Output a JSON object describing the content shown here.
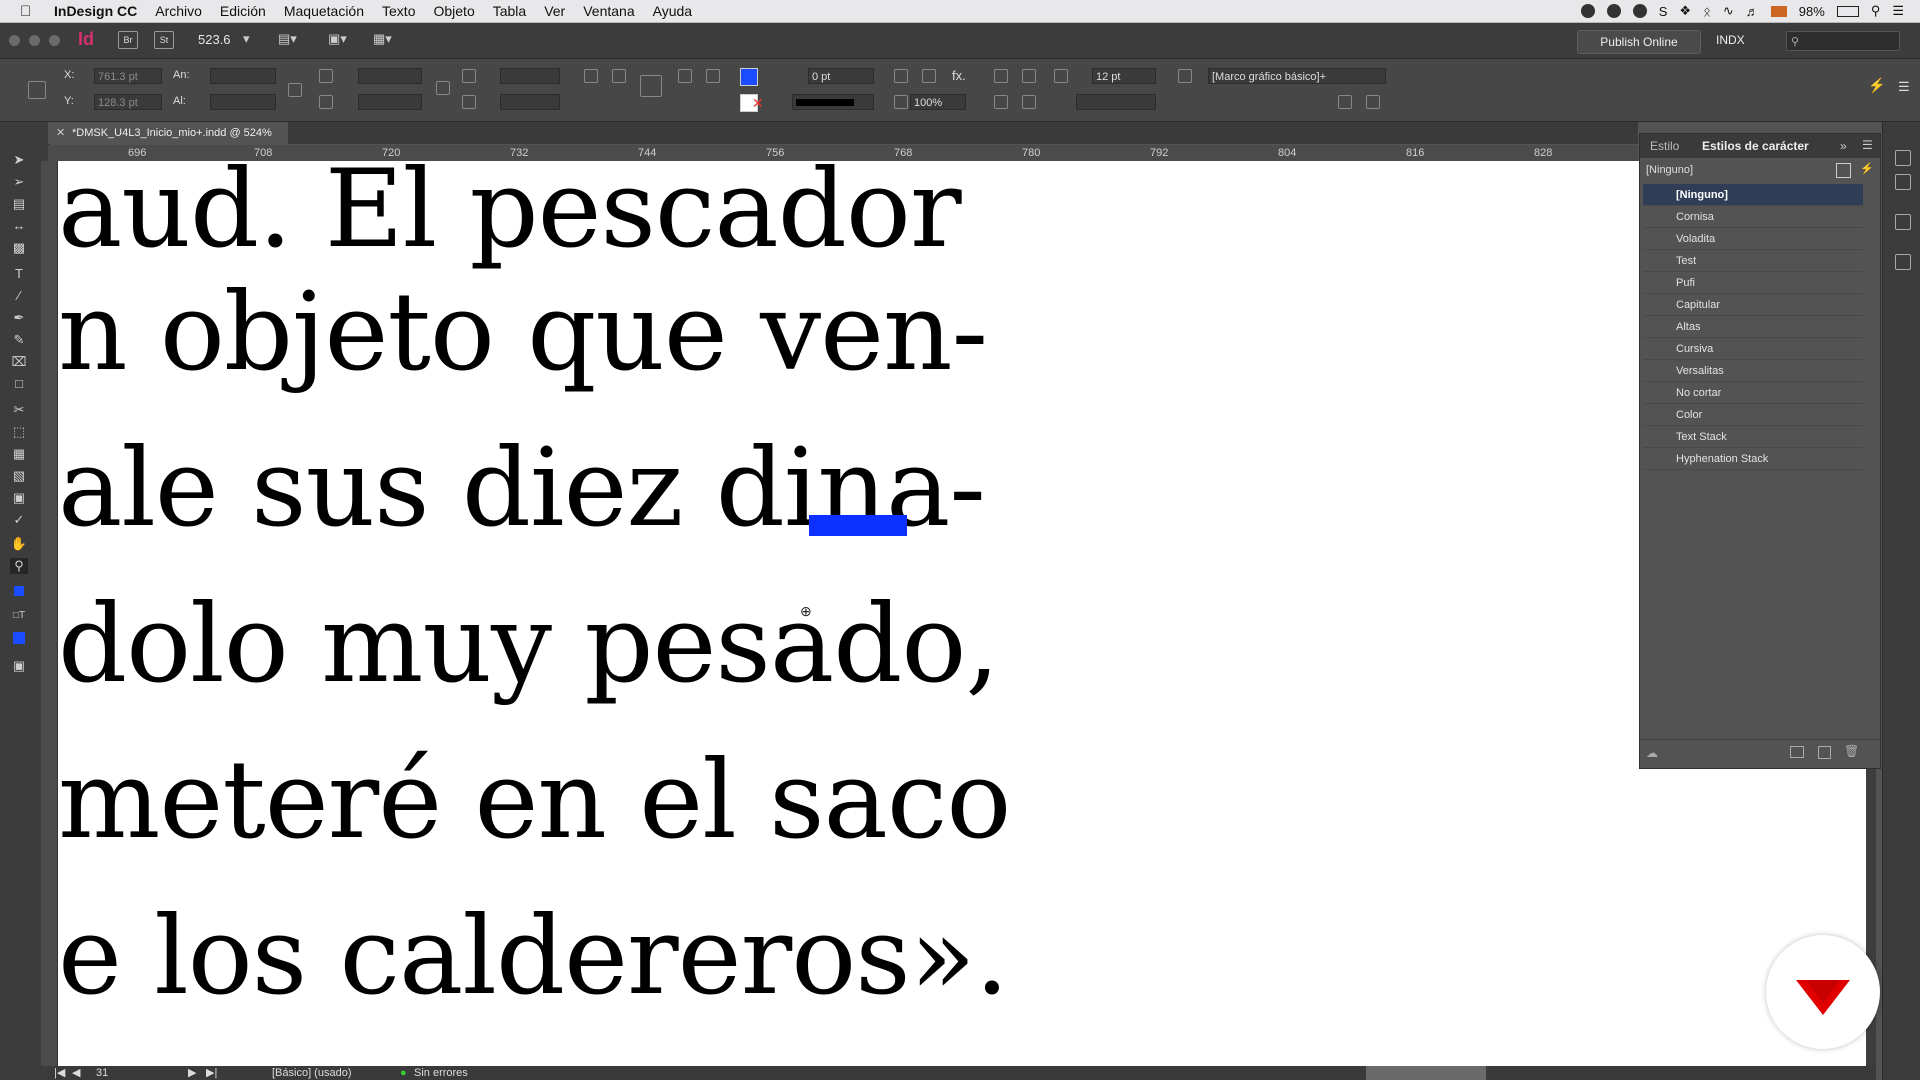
{
  "menubar": {
    "app_name": "InDesign CC",
    "menus": [
      "Archivo",
      "Edición",
      "Maquetación",
      "Texto",
      "Objeto",
      "Tabla",
      "Ver",
      "Ventana",
      "Ayuda"
    ],
    "battery": "98%"
  },
  "appbar": {
    "logo": "Id",
    "bridge_label": "Br",
    "stock_label": "St",
    "zoom": "523.6",
    "publish_label": "Publish Online",
    "workspace": "INDX"
  },
  "control": {
    "x_label": "X:",
    "x_value": "761.3 pt",
    "y_label": "Y:",
    "y_value": "128.3 pt",
    "w_label": "An:",
    "h_label": "Al:",
    "stroke_weight": "0 pt",
    "stroke_offset": "12 pt",
    "opacity": "100%",
    "frame_style": "[Marco gráfico básico]+",
    "fill_color": "#1a4dff"
  },
  "document": {
    "tab_title": "*DMSK_U4L3_Inicio_mio+.indd @ 524%",
    "ruler_ticks": [
      "696",
      "708",
      "720",
      "732",
      "744",
      "756",
      "768",
      "780",
      "792",
      "804",
      "816",
      "828"
    ],
    "text_lines": [
      "aud. El pescador",
      "n objeto que ven-",
      "ale sus diez dina-",
      "dolo muy pesado,",
      "meteré en el saco",
      "e los caldereros»."
    ]
  },
  "panel": {
    "tab_styles": "Estilo",
    "tab_char_styles": "Estilos de carácter",
    "current": "[Ninguno]",
    "items": [
      "[Ninguno]",
      "Cornisa",
      "Voladita",
      "Test",
      "Pufi",
      "Capitular",
      "Altas",
      "Cursiva",
      "Versalitas",
      "No cortar",
      "Color",
      "Text Stack",
      "Hyphenation Stack"
    ]
  },
  "status": {
    "page": "31",
    "style": "[Básico] (usado)",
    "errors": "Sin errores"
  }
}
